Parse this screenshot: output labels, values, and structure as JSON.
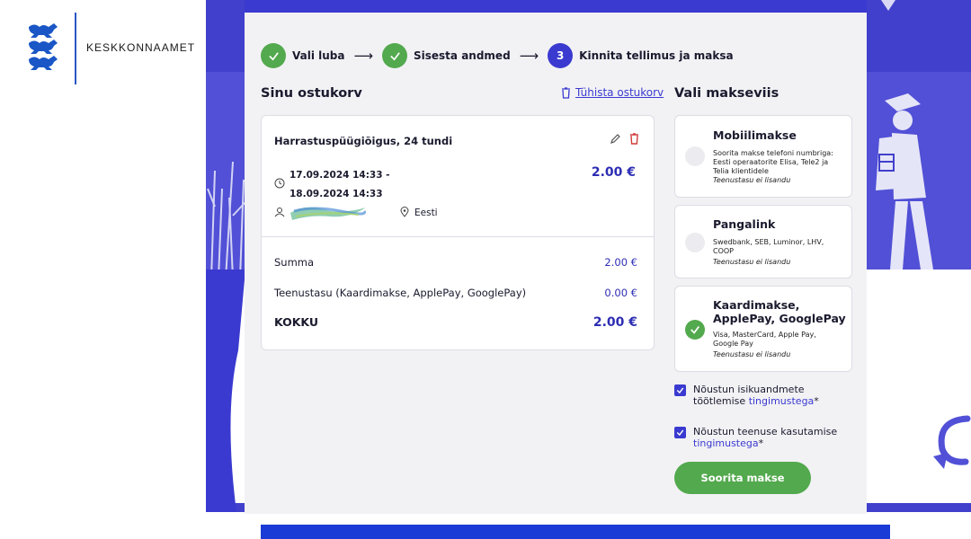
{
  "brand": {
    "name": "KESKKONNAAMET"
  },
  "steps": [
    {
      "label": "Vali luba",
      "state": "done"
    },
    {
      "label": "Sisesta andmed",
      "state": "done"
    },
    {
      "number": "3",
      "label": "Kinnita tellimus ja maksa",
      "state": "current"
    }
  ],
  "cart": {
    "title": "Sinu ostukorv",
    "clear_label": "Tühista ostukorv",
    "item": {
      "name": "Harrastuspüügiõigus, 24 tundi",
      "date_from": "17.09.2024 14:33 -",
      "date_to": "18.09.2024 14:33",
      "price": "2.00 €",
      "country": "Eesti"
    },
    "summary": [
      {
        "label": "Summa",
        "value": "2.00 €"
      },
      {
        "label": "Teenustasu (Kaardimakse, ApplePay, GooglePay)",
        "value": "0.00 €"
      }
    ],
    "total": {
      "label": "KOKKU",
      "value": "2.00 €"
    }
  },
  "payment": {
    "title": "Vali makseviis",
    "methods": [
      {
        "name": "Mobiilimakse",
        "desc": "Soorita makse telefoni numbriga: Eesti operaatorite Elisa, Tele2 ja Telia klientidele",
        "fee": "Teenustasu ei lisandu",
        "selected": false
      },
      {
        "name": "Pangalink",
        "desc": "Swedbank, SEB, Luminor, LHV, COOP",
        "fee": "Teenustasu ei lisandu",
        "selected": false
      },
      {
        "name": "Kaardimakse, ApplePay, GooglePay",
        "desc": "Visa, MasterCard, Apple Pay, Google Pay",
        "fee": "Teenustasu ei lisandu",
        "selected": true
      }
    ],
    "consents": [
      {
        "text": "Nõustun isikuandmete töötlemise",
        "link": "tingimustega",
        "suffix": "*",
        "checked": true
      },
      {
        "text": "Nõustun teenuse kasutamise",
        "link": "tingimustega",
        "suffix": "*",
        "checked": true
      }
    ],
    "submit_label": "Soorita makse"
  },
  "colors": {
    "primary": "#3a3ad0",
    "success": "#53a94d",
    "price": "#2d2db4",
    "panel": "#f2f2f5"
  }
}
